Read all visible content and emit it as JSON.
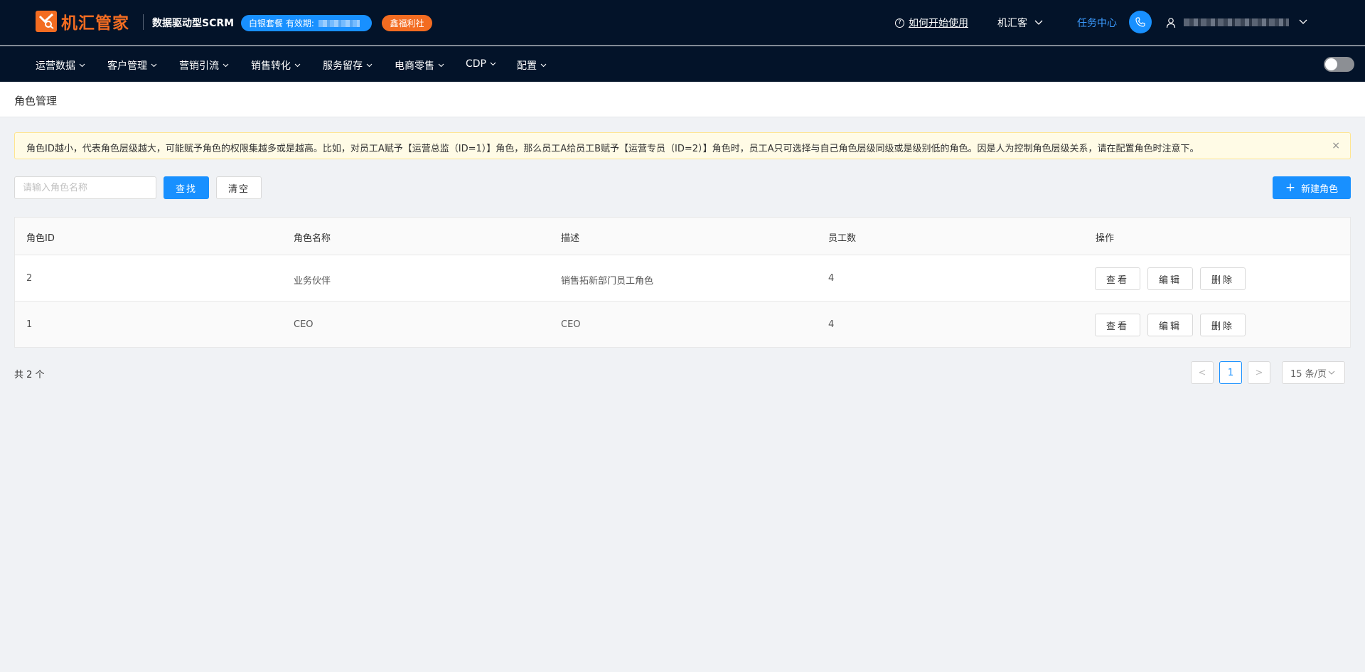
{
  "header": {
    "logo_text": "机汇管家",
    "slogan": "数据驱动型SCRM",
    "package_badge": "白银套餐 有效期:",
    "welfare_badge": "鑫福利社",
    "help_link": "如何开始使用",
    "brand_dropdown": "机汇客",
    "task_center": "任务中心"
  },
  "nav": {
    "items": [
      {
        "label": "运营数据"
      },
      {
        "label": "客户管理"
      },
      {
        "label": "营销引流"
      },
      {
        "label": "销售转化"
      },
      {
        "label": "服务留存"
      },
      {
        "label": "电商零售"
      },
      {
        "label": "CDP"
      },
      {
        "label": "配置"
      }
    ]
  },
  "breadcrumb": "角色管理",
  "alert": {
    "text": "角色ID越小，代表角色层级越大，可能赋予角色的权限集越多或是越高。比如，对员工A赋予【运营总监（ID=1）】角色，那么员工A给员工B赋予【运营专员（ID=2）】角色时，员工A只可选择与自己角色层级同级或是级别低的角色。因是人为控制角色层级关系，请在配置角色时注意下。",
    "close": "×"
  },
  "filters": {
    "search_placeholder": "请输入角色名称",
    "search_value": "",
    "search_button": "查找",
    "clear_button": "清空",
    "new_role_button": "新建角色"
  },
  "table": {
    "columns": [
      "角色ID",
      "角色名称",
      "描述",
      "员工数",
      "操作"
    ],
    "rows": [
      {
        "id": "2",
        "name": "业务伙伴",
        "desc": "销售拓新部门员工角色",
        "count": "4"
      },
      {
        "id": "1",
        "name": "CEO",
        "desc": "CEO",
        "count": "4"
      }
    ],
    "actions": {
      "view": "查看",
      "edit": "编辑",
      "delete": "删除"
    }
  },
  "pagination": {
    "total": "共 2 个",
    "prev": "<",
    "current": "1",
    "next": ">",
    "page_size": "15 条/页"
  }
}
